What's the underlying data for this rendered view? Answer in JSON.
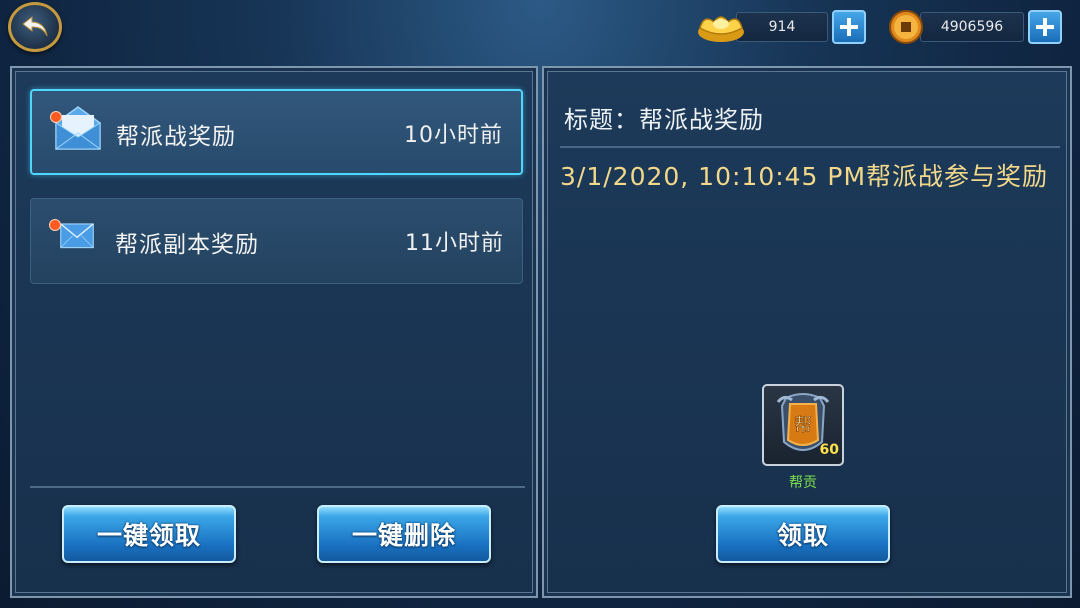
{
  "topbar": {
    "gold": {
      "icon": "gold-ingot-icon",
      "value": "914"
    },
    "coins": {
      "icon": "copper-coin-icon",
      "value": "4906596"
    }
  },
  "mail_list": [
    {
      "title": "帮派战奖励",
      "time": "10小时前",
      "selected": true
    },
    {
      "title": "帮派副本奖励",
      "time": "11小时前",
      "selected": false
    }
  ],
  "actions": {
    "claim_all": "一键领取",
    "delete_all": "一键删除"
  },
  "detail": {
    "subject": "标题：帮派战奖励",
    "body": "3/1/2020, 10:10:45 PM帮派战参与奖励",
    "reward": {
      "name": "帮贡",
      "quantity": "60",
      "icon": "guild-contribution-icon",
      "glyph": "帮"
    },
    "claim_label": "领取"
  },
  "colors": {
    "accent": "#4fd6ff",
    "body_text": "#f3d88a",
    "reward_name": "#7de04d",
    "unread_dot": "#ff5a1f"
  }
}
